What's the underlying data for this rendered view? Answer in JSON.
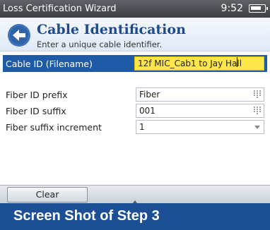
{
  "titlebar": {
    "app_title": "Loss Certification Wizard",
    "time": "9:52"
  },
  "header": {
    "title": "Cable Identification",
    "subtitle": "Enter a unique cable identifier."
  },
  "cable_id": {
    "label": "Cable ID (Filename)",
    "value": "12f MIC_Cab1 to Jay Hall"
  },
  "fields": {
    "prefix": {
      "label": "Fiber ID prefix",
      "value": "Fiber"
    },
    "suffix": {
      "label": "Fiber ID suffix",
      "value": "001"
    },
    "increment": {
      "label": "Fiber suffix increment",
      "value": "1"
    }
  },
  "buttons": {
    "clear": "Clear"
  },
  "caption": "Screen Shot of Step 3",
  "colors": {
    "accent": "#1f5aa6",
    "highlight": "#fde54a",
    "title": "#1e4a8c"
  }
}
